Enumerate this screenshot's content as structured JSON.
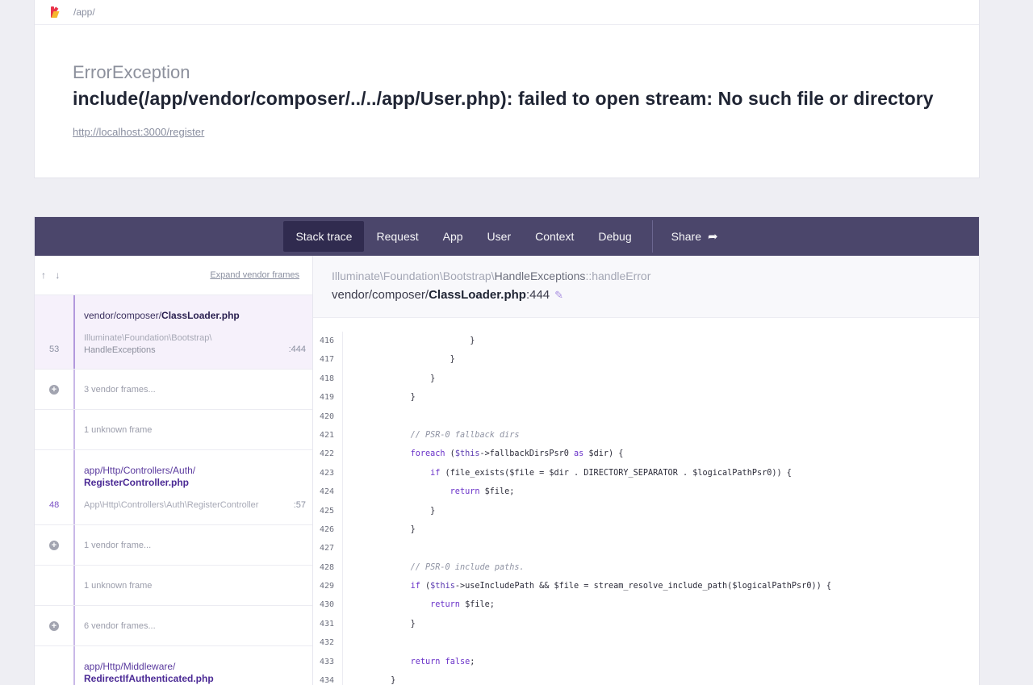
{
  "header": {
    "app_path": "/app/",
    "exception_class": "ErrorException",
    "exception_message": "include(/app/vendor/composer/../../app/User.php): failed to open stream: No such file or directory",
    "url": "http://localhost:3000/register"
  },
  "nav": {
    "tabs": [
      "Stack trace",
      "Request",
      "App",
      "User",
      "Context",
      "Debug"
    ],
    "active_tab": "Stack trace",
    "share_label": "Share"
  },
  "sidebar": {
    "sort_arrows": "↑ ↓",
    "expand_label": "Expand vendor frames",
    "frames": [
      {
        "kind": "frame",
        "selected": true,
        "line_number": "53",
        "path_prefix": "vendor/composer/",
        "path_file": "ClassLoader.php",
        "class_line1": "Illuminate\\Foundation\\Bootstrap\\",
        "class_line2": "HandleExceptions",
        "line": ":444"
      },
      {
        "kind": "vendor",
        "text": "3 vendor frames..."
      },
      {
        "kind": "unknown",
        "text": "1 unknown frame"
      },
      {
        "kind": "frame",
        "selected": false,
        "line_number": "48",
        "path_prefix": "app/Http/Controllers/Auth/",
        "path_file": "RegisterController.php",
        "class_line1": "App\\Http\\Controllers\\Auth\\RegisterController",
        "line": ":57"
      },
      {
        "kind": "vendor",
        "text": "1 vendor frame..."
      },
      {
        "kind": "unknown",
        "text": "1 unknown frame"
      },
      {
        "kind": "vendor",
        "text": "6 vendor frames..."
      },
      {
        "kind": "frame",
        "selected": false,
        "path_prefix": "app/Http/Middleware/",
        "path_file": "RedirectIfAuthenticated.php"
      }
    ]
  },
  "main": {
    "namespace": "Illuminate\\Foundation\\Bootstrap\\",
    "class": "HandleExceptions",
    "method_sep": "::",
    "method": "handleError",
    "file_prefix": "vendor/composer/",
    "file_name": "ClassLoader.php",
    "file_line": ":444",
    "code": [
      {
        "n": "416",
        "text": "                }"
      },
      {
        "n": "417",
        "text": "            }"
      },
      {
        "n": "418",
        "text": "        }"
      },
      {
        "n": "419",
        "text": "    }"
      },
      {
        "n": "420",
        "text": ""
      },
      {
        "n": "421",
        "text": "    // PSR-0 fallback dirs"
      },
      {
        "n": "422",
        "text": "    foreach ($this->fallbackDirsPsr0 as $dir) {"
      },
      {
        "n": "423",
        "text": "        if (file_exists($file = $dir . DIRECTORY_SEPARATOR . $logicalPathPsr0)) {"
      },
      {
        "n": "424",
        "text": "            return $file;"
      },
      {
        "n": "425",
        "text": "        }"
      },
      {
        "n": "426",
        "text": "    }"
      },
      {
        "n": "427",
        "text": ""
      },
      {
        "n": "428",
        "text": "    // PSR-0 include paths."
      },
      {
        "n": "429",
        "text": "    if ($this->useIncludePath && $file = stream_resolve_include_path($logicalPathPsr0)) {"
      },
      {
        "n": "430",
        "text": "        return $file;"
      },
      {
        "n": "431",
        "text": "    }"
      },
      {
        "n": "432",
        "text": ""
      },
      {
        "n": "433",
        "text": "    return false;"
      },
      {
        "n": "434",
        "text": "}"
      }
    ]
  }
}
